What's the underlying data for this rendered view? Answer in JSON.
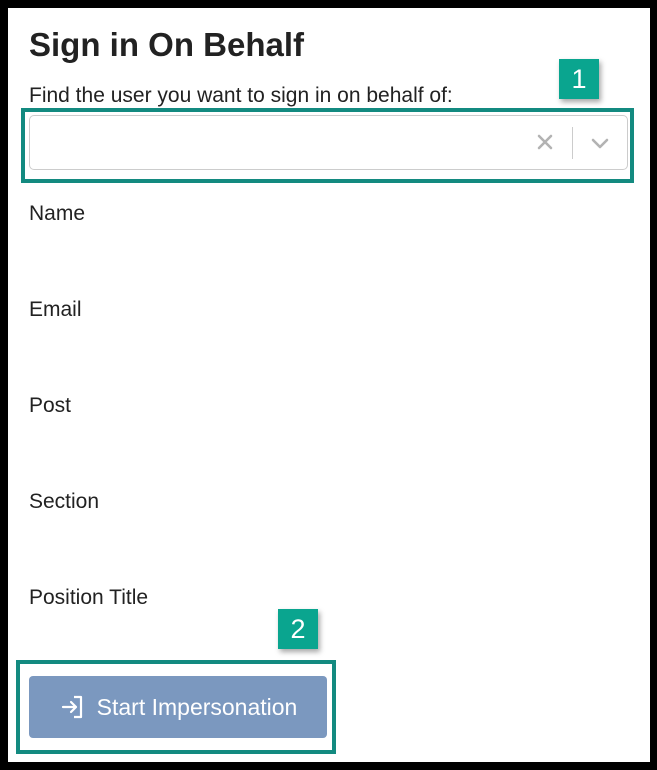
{
  "page": {
    "title": "Sign in On Behalf",
    "instruction": "Find the user you want to sign in on behalf of:"
  },
  "search": {
    "value": "",
    "placeholder": "",
    "clear_icon": "close-icon",
    "dropdown_icon": "chevron-down-icon"
  },
  "fields": {
    "name_label": "Name",
    "email_label": "Email",
    "post_label": "Post",
    "section_label": "Section",
    "position_title_label": "Position Title"
  },
  "actions": {
    "start_label": "Start Impersonation",
    "start_icon": "sign-in-icon"
  },
  "callouts": {
    "first": "1",
    "second": "2"
  },
  "colors": {
    "highlight_border": "#138a80",
    "callout_bg": "#0aa58f",
    "button_bg": "#7b98bf",
    "frame_border": "#000000"
  }
}
